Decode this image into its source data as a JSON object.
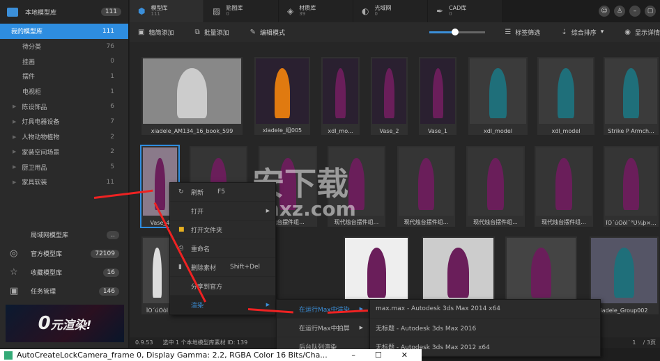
{
  "sidebar": {
    "header": {
      "label": "本地模型库",
      "count": "111"
    },
    "items": [
      {
        "label": "我的模型库",
        "count": "111",
        "selected": true
      },
      {
        "label": "待分类",
        "count": "76"
      },
      {
        "label": "挂画",
        "count": "0"
      },
      {
        "label": "摆件",
        "count": "1"
      },
      {
        "label": "电视柜",
        "count": "1"
      },
      {
        "label": "陈设饰品",
        "count": "6",
        "expandable": true
      },
      {
        "label": "灯具电器设备",
        "count": "7",
        "expandable": true
      },
      {
        "label": "人物动物植物",
        "count": "2",
        "expandable": true
      },
      {
        "label": "家装空间场景",
        "count": "2",
        "expandable": true
      },
      {
        "label": "厨卫用品",
        "count": "5",
        "expandable": true
      },
      {
        "label": "家具软装",
        "count": "11",
        "expandable": true
      }
    ],
    "bottom": [
      {
        "label": "局域网模型库",
        "count": "..",
        "icon": ""
      },
      {
        "label": "官方模型库",
        "count": "72109",
        "icon": "globe-icon"
      },
      {
        "label": "收藏模型库",
        "count": "16",
        "icon": "star-icon"
      },
      {
        "label": "任务管理",
        "count": "146",
        "icon": "clipboard-icon"
      }
    ],
    "banner": {
      "big": "0",
      "text": "元渲染!"
    }
  },
  "tabs": [
    {
      "label": "模型库",
      "count": "111",
      "icon": "cube-icon",
      "active": true
    },
    {
      "label": "贴图库",
      "count": "0",
      "icon": "image-icon"
    },
    {
      "label": "材质库",
      "count": "39",
      "icon": "material-icon"
    },
    {
      "label": "光域网",
      "count": "0",
      "icon": "light-icon"
    },
    {
      "label": "CAD库",
      "count": "0",
      "icon": "pen-icon"
    }
  ],
  "toolbar": {
    "simple_add": "精简添加",
    "batch_add": "批量添加",
    "edit_mode": "编辑模式",
    "tag_filter": "标签筛选",
    "sort": "综合排序",
    "details": "显示详情",
    "zoom_level": 0.46
  },
  "grid": {
    "rows": [
      [
        "xiadele_AM134_16_book_599",
        "xiadele_组005",
        "xdl_mo...",
        "Vase_2",
        "Vase_1",
        "xdl_model",
        "xdl_model",
        "Strike P Armch..."
      ],
      [
        "Vase_4",
        "",
        "烛台摆件组...",
        "现代烛台摆件组...",
        "现代烛台摆件组...",
        "现代烛台摆件组...",
        "现代烛台摆件组...",
        "ÏÖ´úÖòÌ¨°Ú¼þ×..."
      ],
      [
        "ÏÖ´úÖòÌ",
        "",
        "",
        "",
        "",
        "",
        "",
        "iadele_Group002"
      ]
    ]
  },
  "status": {
    "time": "0.9.53",
    "text": "选中 1 个本地模型库素材 ID: 139",
    "page": "1",
    "pages": "/ 3页"
  },
  "context_menu": [
    {
      "label": "刷新",
      "shortcut": "F5",
      "icon": "refresh-icon"
    },
    {
      "label": "打开",
      "submenu": true
    },
    {
      "label": "打开文件夹",
      "icon": "folder-icon"
    },
    {
      "label": "重命名",
      "icon": "rename-icon"
    },
    {
      "label": "删除素材",
      "shortcut": "Shift+Del",
      "icon": "trash-icon"
    },
    {
      "label": "分享到官方"
    },
    {
      "label": "渲染",
      "submenu": true,
      "highlight": true
    }
  ],
  "render_menu": [
    {
      "label": "在运行Max中渲染",
      "submenu": true,
      "highlight": true
    },
    {
      "label": "在运行Max中拍屏",
      "submenu": true
    },
    {
      "label": "后台队列渲染"
    }
  ],
  "max_menu": [
    "max.max - Autodesk 3ds Max  2014 x64",
    "无标题 - Autodesk 3ds Max 2016",
    "无标题 - Autodesk 3ds Max  2012 x64"
  ],
  "taskbar": {
    "title": "AutoCreateLockCamera_frame 0, Display Gamma: 2.2, RGBA Color 16 Bits/Cha..."
  },
  "watermark": {
    "text": "安下载",
    "sub": "anxz.com"
  }
}
